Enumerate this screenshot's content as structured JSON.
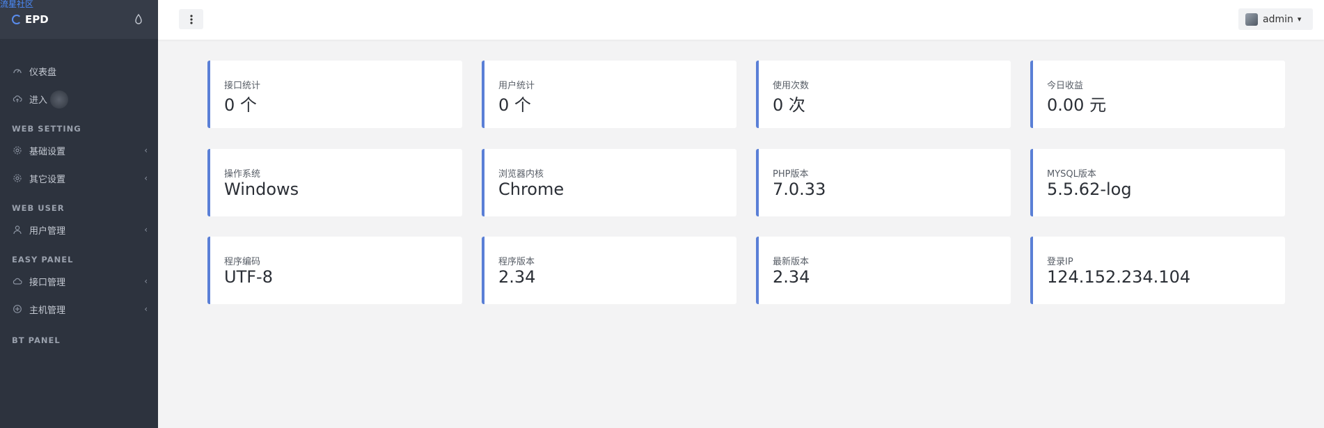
{
  "watermark": "流星社区",
  "brand": {
    "name": "EPD"
  },
  "sidebar": {
    "items": [
      {
        "label": "仪表盘"
      },
      {
        "label": "进入"
      }
    ],
    "sections": [
      {
        "title": "WEB SETTING",
        "items": [
          {
            "label": "基础设置"
          },
          {
            "label": "其它设置"
          }
        ]
      },
      {
        "title": "WEB USER",
        "items": [
          {
            "label": "用户管理"
          }
        ]
      },
      {
        "title": "EASY PANEL",
        "items": [
          {
            "label": "接口管理"
          },
          {
            "label": "主机管理"
          }
        ]
      },
      {
        "title": "BT PANEL",
        "items": []
      }
    ]
  },
  "header": {
    "user_name": "admin"
  },
  "stats": [
    {
      "label": "接口统计",
      "value": "0 个"
    },
    {
      "label": "用户统计",
      "value": "0 个"
    },
    {
      "label": "使用次数",
      "value": "0 次"
    },
    {
      "label": "今日收益",
      "value": "0.00 元"
    },
    {
      "label": "操作系统",
      "value": "Windows"
    },
    {
      "label": "浏览器内核",
      "value": "Chrome"
    },
    {
      "label": "PHP版本",
      "value": "7.0.33"
    },
    {
      "label": "MYSQL版本",
      "value": "5.5.62-log"
    },
    {
      "label": "程序编码",
      "value": "UTF-8"
    },
    {
      "label": "程序版本",
      "value": "2.34"
    },
    {
      "label": "最新版本",
      "value": "2.34"
    },
    {
      "label": "登录IP",
      "value": "124.152.234.104"
    }
  ],
  "colors": {
    "sidebar_bg": "#2d333e",
    "accent": "#5a7fd6",
    "content_bg": "#f3f3f4"
  },
  "icons": [
    "droplet-icon",
    "dashboard-icon",
    "cloud-upload-icon",
    "gear-icon",
    "user-icon",
    "cloud-icon",
    "host-icon",
    "kebab-icon",
    "chevron-down-icon",
    "chevron-left-icon"
  ]
}
